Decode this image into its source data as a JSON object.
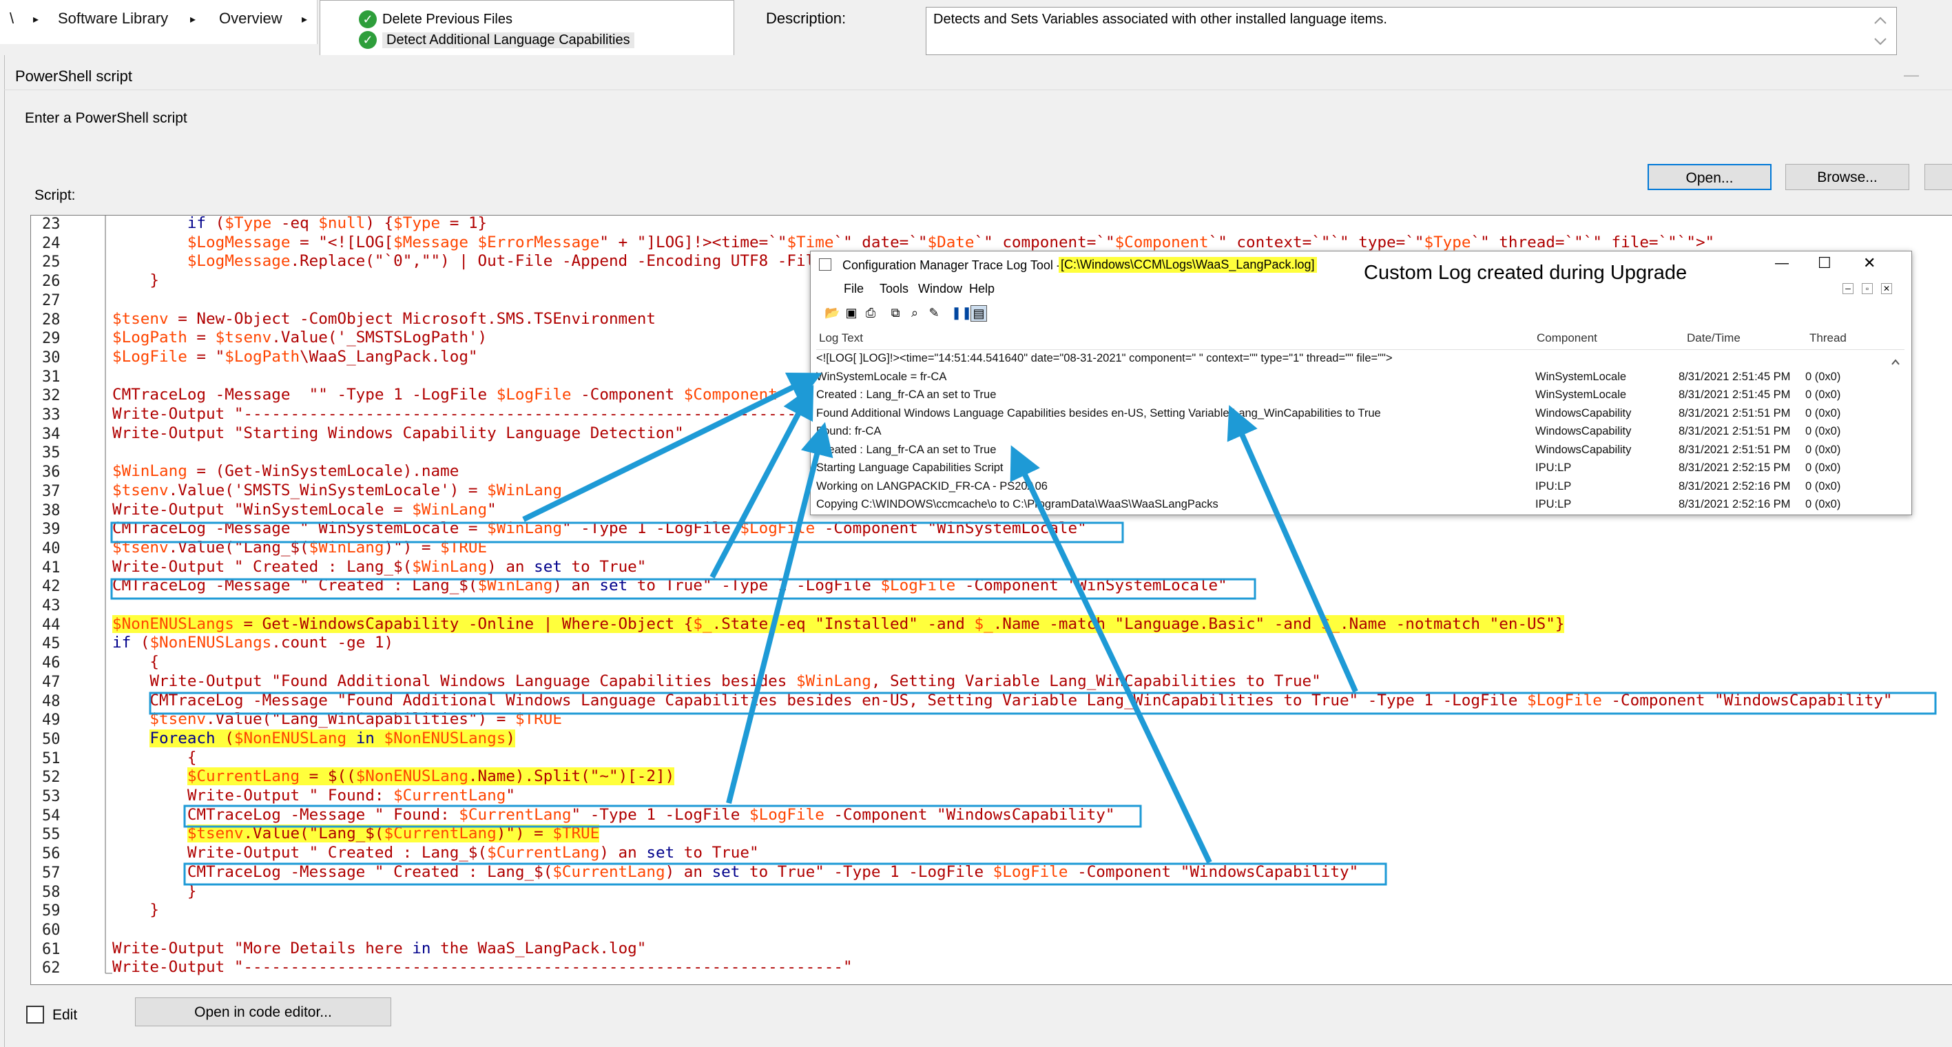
{
  "breadcrumb": {
    "items": [
      "\\",
      "Software Library",
      "Overview"
    ],
    "seps": [
      "▸",
      "▸",
      "▸"
    ]
  },
  "tasks": [
    {
      "label": "Delete Previous Files"
    },
    {
      "label": "Detect Additional Language Capabilities"
    }
  ],
  "description": {
    "label": "Description:",
    "value": "Detects and Sets Variables associated with other installed language items."
  },
  "dialog": {
    "title": "PowerShell script",
    "prompt": "Enter a PowerShell script",
    "script_label": "Script:",
    "open_button": "Open...",
    "browse_button": "Browse...",
    "edit_label": "Edit",
    "code_editor_button": "Open in code editor..."
  },
  "script": {
    "lines": [
      {
        "n": "23",
        "t": "        if ($Type -eq $null) {$Type = 1}"
      },
      {
        "n": "24",
        "t": "        $LogMessage = \"<![LOG[$Message $ErrorMessage\" + \"]LOG]!><time=`\"$Time`\" date=`\"$Date`\" component=`\"$Component`\" context=`\"`\" type=`\"$Type`\" thread=`\"`\" file=`\"`\">\""
      },
      {
        "n": "25",
        "t": "        $LogMessage.Replace(\"`0\",\"\") | Out-File -Append -Encoding UTF8 -FilePath $LogFile"
      },
      {
        "n": "26",
        "t": "    }"
      },
      {
        "n": "27",
        "t": ""
      },
      {
        "n": "28",
        "t": "$tsenv = New-Object -ComObject Microsoft.SMS.TSEnvironment"
      },
      {
        "n": "29",
        "t": "$LogPath = $tsenv.Value('_SMSTSLogPath')"
      },
      {
        "n": "30",
        "t": "$LogFile = \"$LogPath\\WaaS_LangPack.log\""
      },
      {
        "n": "31",
        "t": ""
      },
      {
        "n": "32",
        "t": "CMTraceLog -Message  \"\" -Type 1 -LogFile $LogFile -Component $Component"
      },
      {
        "n": "33",
        "t": "Write-Output \"----------------------------------------------------------------\""
      },
      {
        "n": "34",
        "t": "Write-Output \"Starting Windows Capability Language Detection\""
      },
      {
        "n": "35",
        "t": ""
      },
      {
        "n": "36",
        "t": "$WinLang = (Get-WinSystemLocale).name"
      },
      {
        "n": "37",
        "t": "$tsenv.Value('SMSTS_WinSystemLocale') = $WinLang"
      },
      {
        "n": "38",
        "t": "Write-Output \"WinSystemLocale = $WinLang\""
      },
      {
        "n": "39",
        "t": "CMTraceLog -Message \" WinSystemLocale = $WinLang\" -Type 1 -LogFile $LogFile -Component \"WinSystemLocale\""
      },
      {
        "n": "40",
        "t": "$tsenv.Value(\"Lang_$($WinLang)\") = $TRUE"
      },
      {
        "n": "41",
        "t": "Write-Output \" Created : Lang_$($WinLang) an set to True\""
      },
      {
        "n": "42",
        "t": "CMTraceLog -Message \" Created : Lang_$($WinLang) an set to True\" -Type 1 -LogFile $LogFile -Component \"WinSystemLocale\""
      },
      {
        "n": "43",
        "t": ""
      },
      {
        "n": "44",
        "t": "$NonENUSLangs = Get-WindowsCapability -Online | Where-Object {$_.State -eq \"Installed\" -and $_.Name -match \"Language.Basic\" -and $_.Name -notmatch \"en-US\"}"
      },
      {
        "n": "45",
        "t": "if ($NonENUSLangs.count -ge 1)"
      },
      {
        "n": "46",
        "t": "    {"
      },
      {
        "n": "47",
        "t": "    Write-Output \"Found Additional Windows Language Capabilities besides $WinLang, Setting Variable Lang_WinCapabilities to True\""
      },
      {
        "n": "48",
        "t": "    CMTraceLog -Message \"Found Additional Windows Language Capabilities besides en-US, Setting Variable Lang_WinCapabilities to True\" -Type 1 -LogFile $LogFile -Component \"WindowsCapability\""
      },
      {
        "n": "49",
        "t": "    $tsenv.Value(\"Lang_WinCapabilities\") = $TRUE"
      },
      {
        "n": "50",
        "t": "    Foreach ($NonENUSLang in $NonENUSLangs)"
      },
      {
        "n": "51",
        "t": "        {"
      },
      {
        "n": "52",
        "t": "        $CurrentLang = $(($NonENUSLang.Name).Split(\"~\")[-2])"
      },
      {
        "n": "53",
        "t": "        Write-Output \" Found: $CurrentLang\""
      },
      {
        "n": "54",
        "t": "        CMTraceLog -Message \" Found: $CurrentLang\" -Type 1 -LogFile $LogFile -Component \"WindowsCapability\""
      },
      {
        "n": "55",
        "t": "        $tsenv.Value(\"Lang_$($CurrentLang)\") = $TRUE"
      },
      {
        "n": "56",
        "t": "        Write-Output \" Created : Lang_$($CurrentLang) an set to True\""
      },
      {
        "n": "57",
        "t": "        CMTraceLog -Message \" Created : Lang_$($CurrentLang) an set to True\" -Type 1 -LogFile $LogFile -Component \"WindowsCapability\""
      },
      {
        "n": "58",
        "t": "        }"
      },
      {
        "n": "59",
        "t": "    }"
      },
      {
        "n": "60",
        "t": ""
      },
      {
        "n": "61",
        "t": "Write-Output \"More Details here in the WaaS_LangPack.log\""
      },
      {
        "n": "62",
        "t": "Write-Output \"----------------------------------------------------------------\""
      }
    ]
  },
  "logtool": {
    "title_prefix": "Configuration Manager Trace Log Tool - ",
    "title_path": "[C:\\Windows\\CCM\\Logs\\WaaS_LangPack.log]",
    "menu": [
      "File",
      "Tools",
      "Window",
      "Help"
    ],
    "window_controls": [
      "—",
      "☐",
      "✕"
    ],
    "columns": [
      "Log Text",
      "Component",
      "Date/Time",
      "Thread"
    ],
    "rows": [
      {
        "text": "<![LOG[ ]LOG]!><time=\"14:51:44.541640\" date=\"08-31-2021\" component=\" \" context=\"\" type=\"1\" thread=\"\" file=\"\">",
        "component": "",
        "datetime": "",
        "thread": ""
      },
      {
        "text": "WinSystemLocale = fr-CA",
        "component": "WinSystemLocale",
        "datetime": "8/31/2021 2:51:45 PM",
        "thread": "0 (0x0)"
      },
      {
        "text": "Created : Lang_fr-CA an set to True",
        "component": "WinSystemLocale",
        "datetime": "8/31/2021 2:51:45 PM",
        "thread": "0 (0x0)"
      },
      {
        "text": "Found Additional Windows Language Capabilities besides en-US, Setting Variable Lang_WinCapabilities to True",
        "component": "WindowsCapability",
        "datetime": "8/31/2021 2:51:51 PM",
        "thread": "0 (0x0)"
      },
      {
        "text": "Found: fr-CA",
        "component": "WindowsCapability",
        "datetime": "8/31/2021 2:51:51 PM",
        "thread": "0 (0x0)"
      },
      {
        "text": "Created : Lang_fr-CA an set to True",
        "component": "WindowsCapability",
        "datetime": "8/31/2021 2:51:51 PM",
        "thread": "0 (0x0)"
      },
      {
        "text": "Starting Language Capabilities Script",
        "component": "IPU:LP",
        "datetime": "8/31/2021 2:52:15 PM",
        "thread": "0 (0x0)"
      },
      {
        "text": "Working on LANGPACKID_FR-CA - PS20A06",
        "component": "IPU:LP",
        "datetime": "8/31/2021 2:52:16 PM",
        "thread": "0 (0x0)"
      },
      {
        "text": "Copying C:\\WINDOWS\\ccmcache\\o to C:\\ProgramData\\WaaS\\WaaSLangPacks",
        "component": "IPU:LP",
        "datetime": "8/31/2021 2:52:16 PM",
        "thread": "0 (0x0)"
      }
    ]
  },
  "callout": "Custom Log created during Upgrade",
  "colors": {
    "annotation": "#1e9ad6",
    "highlight": "#ffff3c",
    "string": "#b00000",
    "keyword": "#00008b",
    "variable": "#ff4500"
  }
}
